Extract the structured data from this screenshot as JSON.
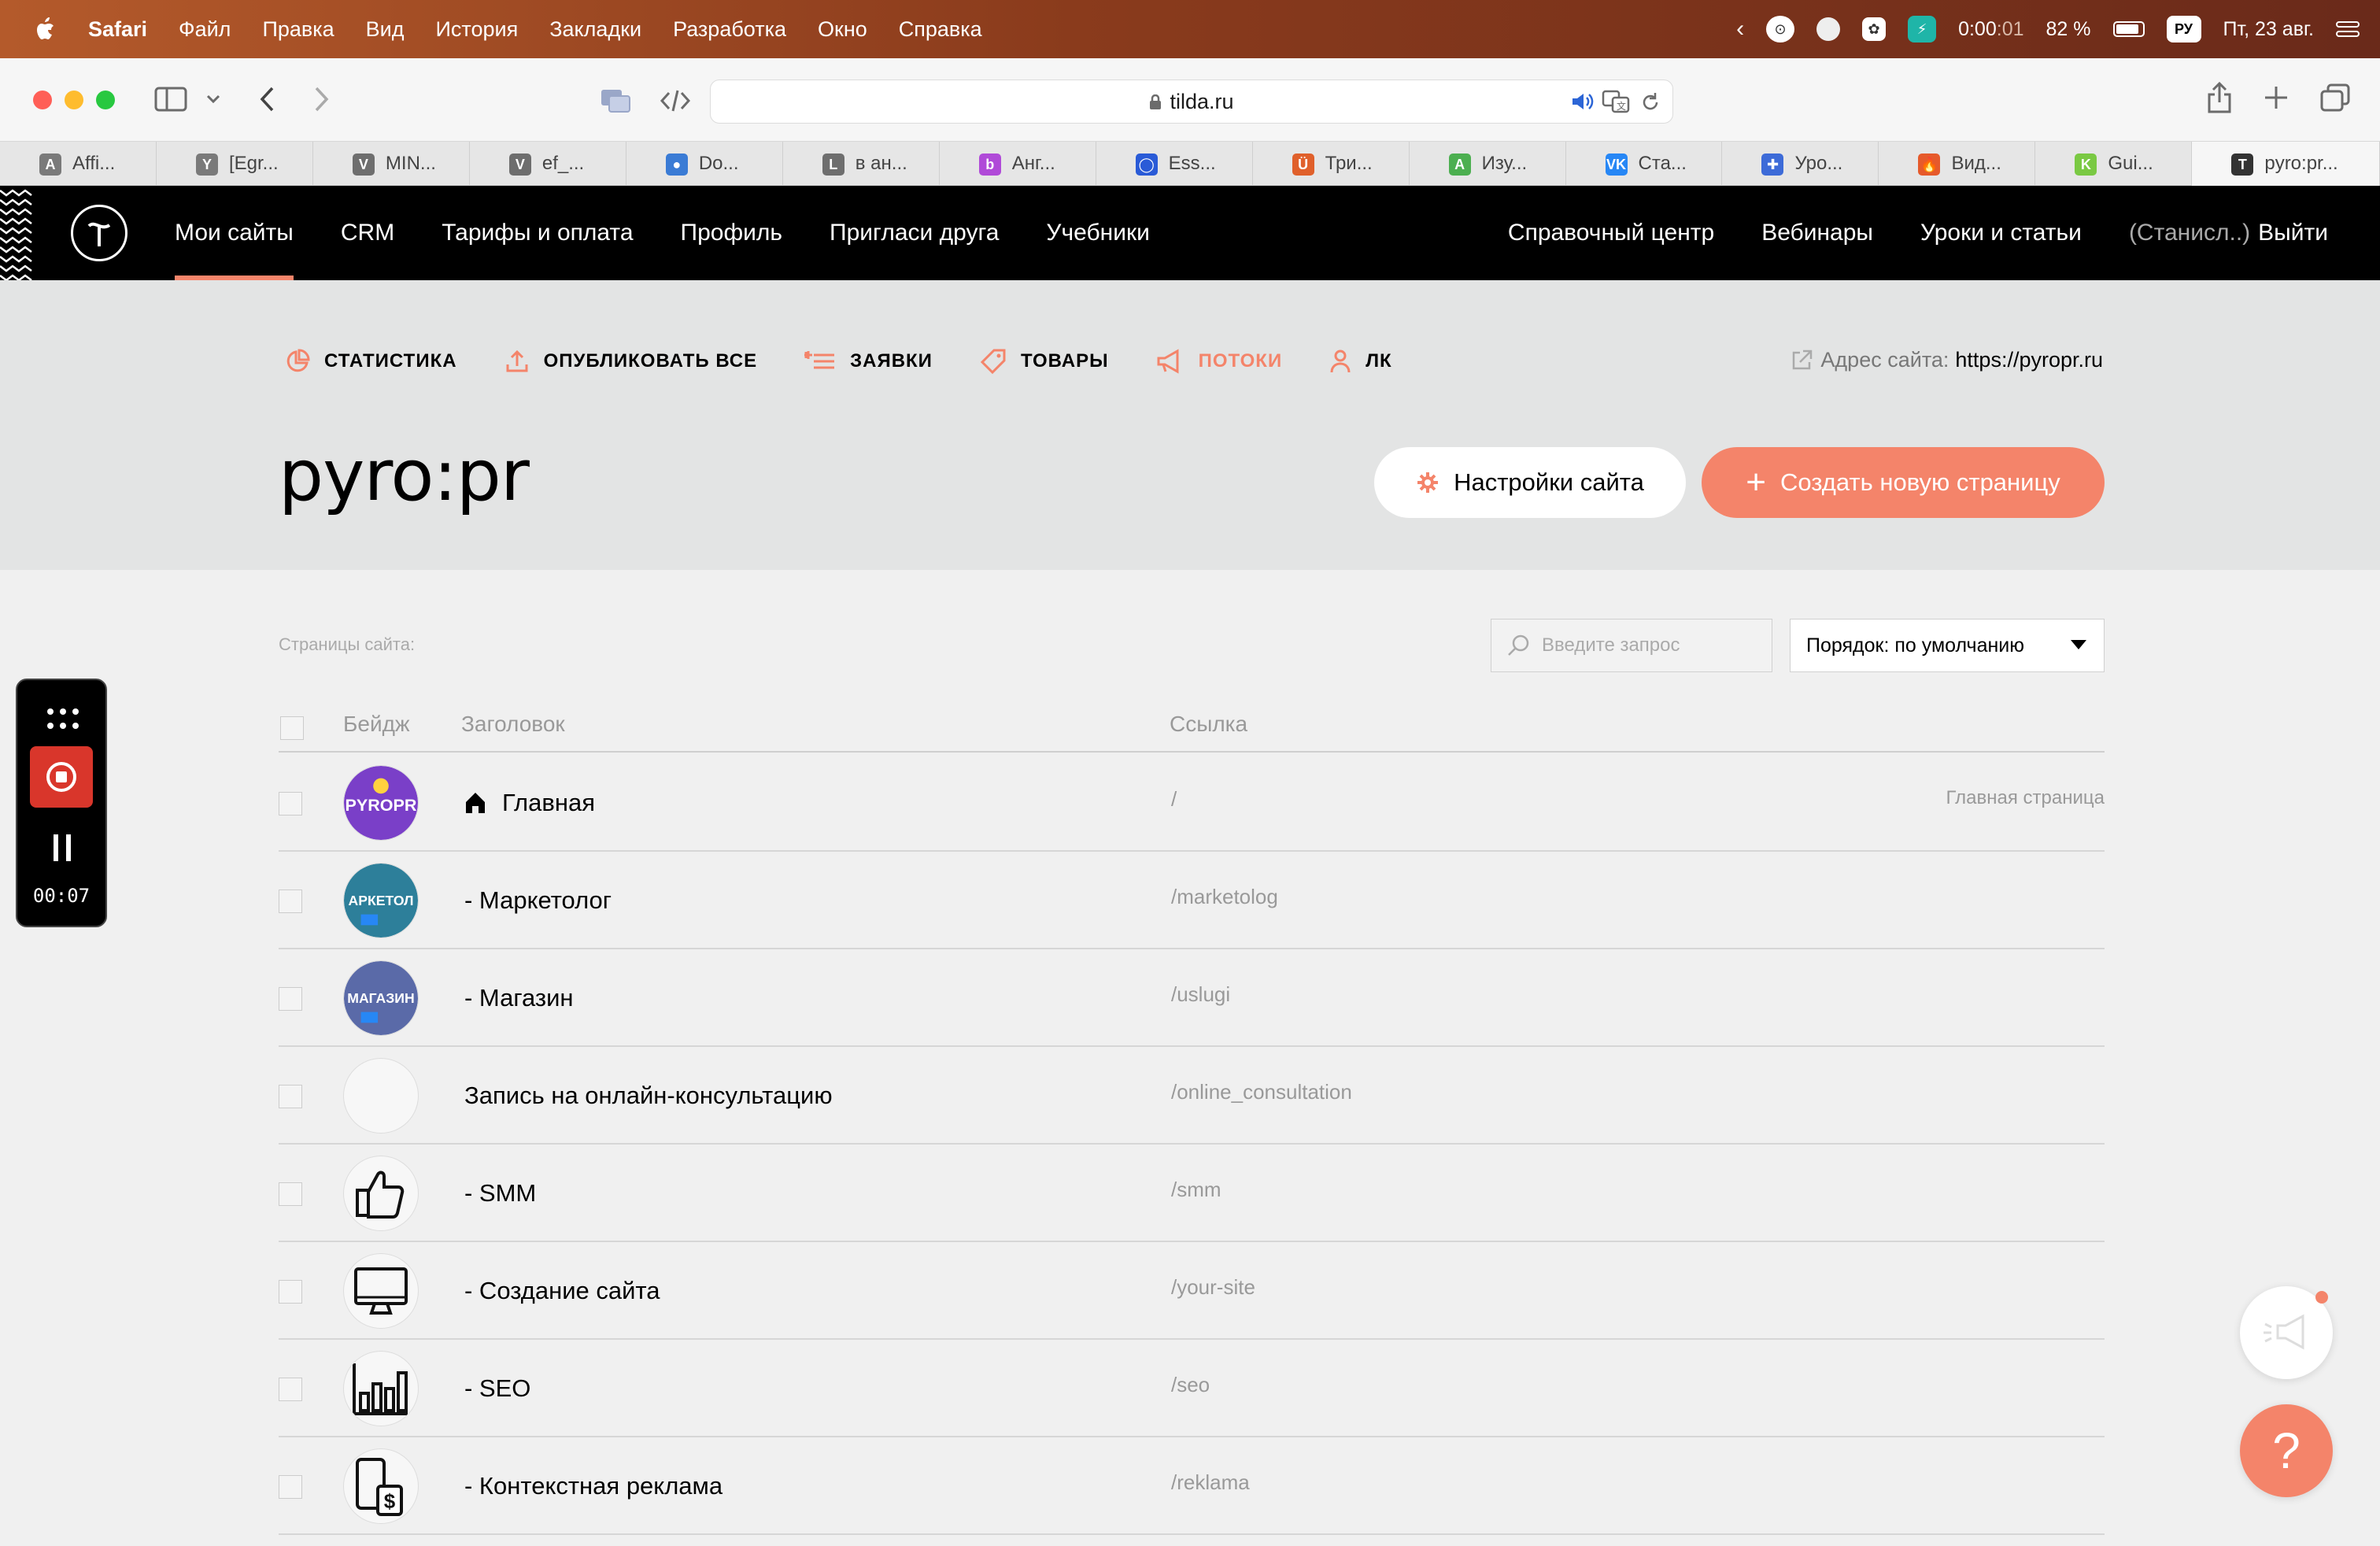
{
  "menubar": {
    "app": "Safari",
    "items": [
      "Файл",
      "Правка",
      "Вид",
      "История",
      "Закладки",
      "Разработка",
      "Окно",
      "Справка"
    ],
    "timer": "0:00",
    "timer_sec": ":01",
    "battery": "82 %",
    "input_lang": "РУ",
    "datetime": "Пт, 23 авг."
  },
  "browser": {
    "url": "tilda.ru",
    "tabs": [
      {
        "label": "Affi...",
        "fav": "A",
        "color": "#7a7a7a"
      },
      {
        "label": "[Egr...",
        "fav": "Y",
        "color": "#7a7a7a"
      },
      {
        "label": "MIN...",
        "fav": "V",
        "color": "#6e6e6e"
      },
      {
        "label": "ef_...",
        "fav": "V",
        "color": "#6e6e6e"
      },
      {
        "label": "Do...",
        "fav": "●",
        "color": "#3a7bd5"
      },
      {
        "label": "в ан...",
        "fav": "L",
        "color": "#6e6e6e"
      },
      {
        "label": "Анг...",
        "fav": "b",
        "color": "#b04ad8"
      },
      {
        "label": "Ess...",
        "fav": "◯",
        "color": "#2a5bd7"
      },
      {
        "label": "Три...",
        "fav": "Ü",
        "color": "#e0602b"
      },
      {
        "label": "Изу...",
        "fav": "A",
        "color": "#4caf50"
      },
      {
        "label": "Ста...",
        "fav": "VK",
        "color": "#2787f5"
      },
      {
        "label": "Уро...",
        "fav": "✚",
        "color": "#3d6bd8"
      },
      {
        "label": "Вид...",
        "fav": "🔥",
        "color": "#e65a2b"
      },
      {
        "label": "Gui...",
        "fav": "K",
        "color": "#7ac943"
      },
      {
        "label": "pyro:pr...",
        "fav": "T",
        "color": "#333"
      }
    ]
  },
  "tilda": {
    "nav": [
      "Мои сайты",
      "CRM",
      "Тарифы и оплата",
      "Профиль",
      "Пригласи друга",
      "Учебники"
    ],
    "nav_right": [
      "Справочный центр",
      "Вебинары",
      "Уроки и статьи"
    ],
    "user": "(Станисл..)",
    "logout": "Выйти",
    "subnav": [
      "СТАТИСТИКА",
      "ОПУБЛИКОВАТЬ ВСЕ",
      "ЗАЯВКИ",
      "ТОВАРЫ",
      "ПОТОКИ",
      "ЛК"
    ],
    "site_addr_label": "Адрес сайта:",
    "site_addr": "https://pyropr.ru",
    "site_title": "pyro:pr",
    "settings_btn": "Настройки сайта",
    "create_btn": "Создать новую страницу",
    "pages_label": "Страницы сайта:",
    "search_placeholder": "Введите запрос",
    "order": "Порядок: по умолчанию",
    "columns": [
      "Бейдж",
      "Заголовок",
      "Ссылка"
    ],
    "pages": [
      {
        "title": "Главная",
        "link": "/",
        "note": "Главная страница",
        "badge": "pyropr"
      },
      {
        "title": "- Маркетолог",
        "link": "/marketolog",
        "note": "",
        "badge": "marketolog"
      },
      {
        "title": "- Магазин",
        "link": "/uslugi",
        "note": "",
        "badge": "magazin"
      },
      {
        "title": "Запись на онлайн-консультацию",
        "link": "/online_consultation",
        "note": "",
        "badge": "empty"
      },
      {
        "title": "- SMM",
        "link": "/smm",
        "note": "",
        "badge": "thumb"
      },
      {
        "title": "- Создание сайта",
        "link": "/your-site",
        "note": "",
        "badge": "monitor"
      },
      {
        "title": "- SEO",
        "link": "/seo",
        "note": "",
        "badge": "chart"
      },
      {
        "title": "- Контекстная реклама",
        "link": "/reklama",
        "note": "",
        "badge": "phone"
      }
    ],
    "badge_text": {
      "pyropr": "PYROPR",
      "marketolog": "АРКЕТОЛ",
      "magazin": "МАГАЗИН"
    }
  },
  "recorder": {
    "time": "00:07"
  },
  "help": {
    "label": "?"
  }
}
